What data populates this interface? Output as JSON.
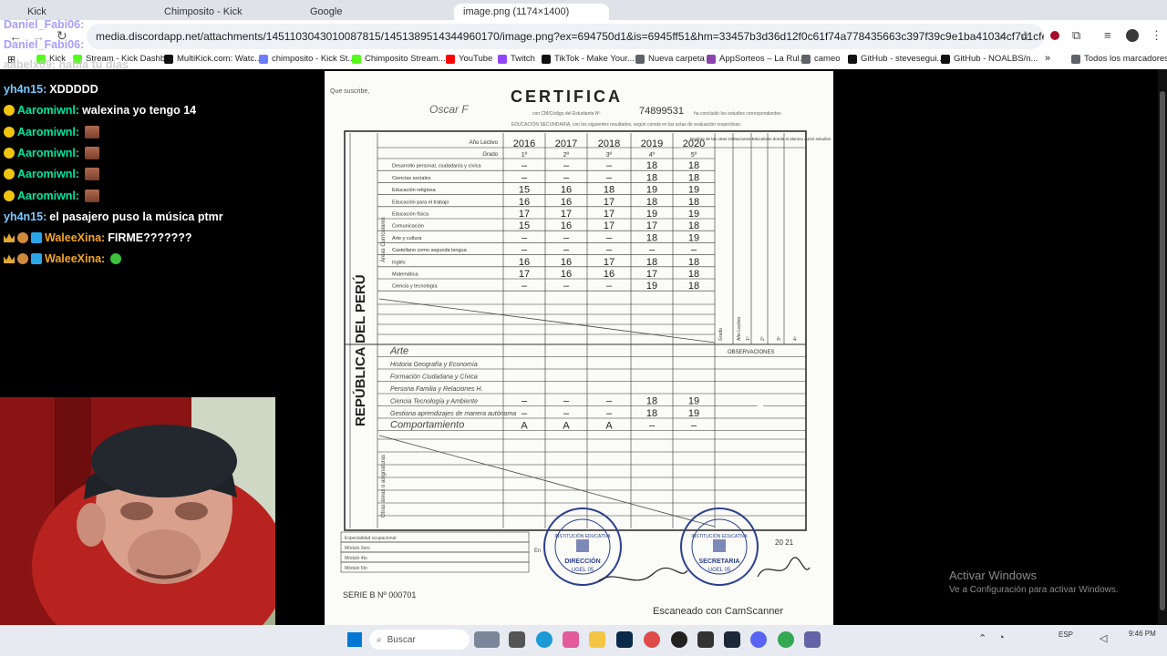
{
  "browser": {
    "tabs": [
      {
        "label": "Kick"
      },
      {
        "label": "Chimposito - Kick"
      },
      {
        "label": "Google"
      },
      {
        "label": "image.png (1174×1400)",
        "active": true
      }
    ],
    "url": "media.discordapp.net/attachments/1451103043010087815/1451389514344960170/image.png?ex=694750d1&is=6945ff51&hm=33457b3d36d12f0c61f74a778435663c397f39c9e1ba41034cf7d1cfe475b252&=&format=webp&quality=los..."
  },
  "bookmarks": [
    {
      "label": "Kick",
      "color": "#53fc18"
    },
    {
      "label": "Stream - Kick Dashb...",
      "color": "#53fc18"
    },
    {
      "label": "MultiKick.com: Watc...",
      "color": "#111111"
    },
    {
      "label": "chimposito - Kick St...",
      "color": "#6b7cff"
    },
    {
      "label": "Chimposito Stream...",
      "color": "#53fc18"
    },
    {
      "label": "YouTube",
      "color": "#ff0000"
    },
    {
      "label": "Twitch",
      "color": "#9146ff"
    },
    {
      "label": "TikTok - Make Your...",
      "color": "#111111"
    },
    {
      "label": "Nueva carpeta",
      "color": "#5f6368"
    },
    {
      "label": "AppSorteos – La Rul...",
      "color": "#8e44ad"
    },
    {
      "label": "cameo",
      "color": "#5f6368"
    },
    {
      "label": "GitHub - stevesegui...",
      "color": "#111111"
    },
    {
      "label": "GitHub - NOALBS/n...",
      "color": "#111111"
    }
  ],
  "bookmarks_all": "Todos los marcadores",
  "chat": {
    "partial_top": [
      {
        "user": "Daniel_Fabi06:",
        "color": "#9b8cff"
      },
      {
        "user": "Daniel_Fabi06:",
        "color": "#9b8cff"
      },
      {
        "user": "aabelx09: habla tu dias",
        "color": "#c8c8c8"
      }
    ],
    "messages": [
      {
        "user": "yh4n15:",
        "text": "XDDDDD",
        "user_color": "#7ec8ff",
        "badge": "none"
      },
      {
        "user": "Aaromiwnl:",
        "text": "walexina yo tengo 14",
        "user_color": "#00e6a0",
        "badge": "coin"
      },
      {
        "user": "Aaromiwnl:",
        "text": "",
        "user_color": "#00e6a0",
        "badge": "coin",
        "emote": true
      },
      {
        "user": "Aaromiwnl:",
        "text": "",
        "user_color": "#00e6a0",
        "badge": "coin",
        "emote": true
      },
      {
        "user": "Aaromiwnl:",
        "text": "",
        "user_color": "#00e6a0",
        "badge": "coin",
        "emote": true
      },
      {
        "user": "Aaromiwnl:",
        "text": "",
        "user_color": "#00e6a0",
        "badge": "coin",
        "emote": true
      },
      {
        "user": "yh4n15:",
        "text": "el pasajero puso la música ptmr",
        "user_color": "#7ec8ff",
        "badge": "none"
      },
      {
        "user": "WaleeXina:",
        "text": "FIRME???????",
        "user_color": "#f5a623",
        "badge": "crown"
      },
      {
        "user": "WaleeXina:",
        "text": "",
        "user_color": "#f5a623",
        "badge": "crown",
        "emote_green": true
      }
    ]
  },
  "document": {
    "title": "CERTIFICA",
    "intro_1": "Que suscribe,",
    "name": "Oscar F",
    "code": "74899531",
    "intro_text": "con CM/Código del Estudiante Nº",
    "intro_text_2": "ha concluido los estudios correspondientes",
    "intro_text_3": "EDUCACIÓN SECUNDARIA, con los siguientes resultados, según consta en las actas de evaluación respectivas:",
    "vertical_label": "REPÚBLICA DEL PERÚ",
    "areas_label": "Áreas Curriculares",
    "header_year_label": "Año Lectivo",
    "header_grade_label": "Grado",
    "years": [
      "2016",
      "2017",
      "2018",
      "2019",
      "2020"
    ],
    "grades": [
      "1º",
      "2º",
      "3º",
      "4º",
      "5º"
    ],
    "inst_header": "Nombre de las otras instituciones Educativas donde el alumno cursó estudios",
    "rows": [
      {
        "subject": "Desarrollo personal, ciudadanía y cívica",
        "v": [
          "–",
          "–",
          "–",
          "18",
          "18"
        ]
      },
      {
        "subject": "Ciencias sociales",
        "v": [
          "–",
          "–",
          "–",
          "18",
          "18"
        ]
      },
      {
        "subject": "Educación religiosa",
        "v": [
          "15",
          "16",
          "18",
          "19",
          "19"
        ]
      },
      {
        "subject": "Educación para el trabajo",
        "v": [
          "16",
          "16",
          "17",
          "18",
          "18"
        ]
      },
      {
        "subject": "Educación física",
        "v": [
          "17",
          "17",
          "17",
          "19",
          "19"
        ]
      },
      {
        "subject": "Comunicación",
        "v": [
          "15",
          "16",
          "17",
          "17",
          "18"
        ]
      },
      {
        "subject": "Arte y cultura",
        "v": [
          "–",
          "–",
          "–",
          "18",
          "19"
        ]
      },
      {
        "subject": "Castellano como segunda lengua",
        "v": [
          "–",
          "–",
          "–",
          "–",
          "–"
        ]
      },
      {
        "subject": "Inglés",
        "v": [
          "16",
          "16",
          "17",
          "18",
          "18"
        ]
      },
      {
        "subject": "Matemática",
        "v": [
          "17",
          "16",
          "16",
          "17",
          "18"
        ]
      },
      {
        "subject": "Ciencia y tecnología",
        "v": [
          "–",
          "–",
          "–",
          "19",
          "18"
        ]
      }
    ],
    "lower_label": "Otras áreas o asignaturas",
    "lower_rows": [
      {
        "subject": "Arte",
        "v": [
          "",
          "",
          "",
          "",
          ""
        ]
      },
      {
        "subject": "Historia Geografía y Economía",
        "v": [
          "",
          "",
          "",
          "",
          ""
        ]
      },
      {
        "subject": "Formación Ciudadana y Cívica",
        "v": [
          "",
          "",
          "",
          "",
          ""
        ]
      },
      {
        "subject": "Persona Familia y Relaciones H.",
        "v": [
          "",
          "",
          "",
          "",
          ""
        ]
      },
      {
        "subject": "Ciencia Tecnología y Ambiente",
        "v": [
          "–",
          "–",
          "–",
          "18",
          "19"
        ]
      },
      {
        "subject": "Gestiona aprendizajes de manera autónoma",
        "v": [
          "–",
          "–",
          "–",
          "18",
          "19"
        ]
      },
      {
        "subject": "Comportamiento",
        "v": [
          "A",
          "A",
          "A",
          "–",
          "–"
        ]
      }
    ],
    "side_header": [
      "Grado",
      "Año Lectivo",
      "1º",
      "2º",
      "3º",
      "4º"
    ],
    "observaciones": "OBSERVACIONES",
    "footer_rows": [
      "Especialidad ocupacional",
      "Módulo 3ero",
      "Módulo 4to",
      "Módulo 5to"
    ],
    "serie": "SERIE B   Nº 000701",
    "place": "En",
    "stamp_1": [
      "INSTITUCIÓN EDUCATIVA",
      "DIRECCIÓN",
      "UGEL 05"
    ],
    "stamp_2": [
      "INSTITUCIÓN EDUCATIVA",
      "SECRETARIA",
      "UGEL 05"
    ],
    "date": "20 21",
    "scan_label": "Escaneado con CamScanner"
  },
  "watermark": {
    "title": "Activar Windows",
    "subtitle": "Ve a Configuración para activar Windows."
  },
  "taskbar": {
    "search_placeholder": "Buscar",
    "lang": "ESP",
    "time": "9:46 PM"
  }
}
